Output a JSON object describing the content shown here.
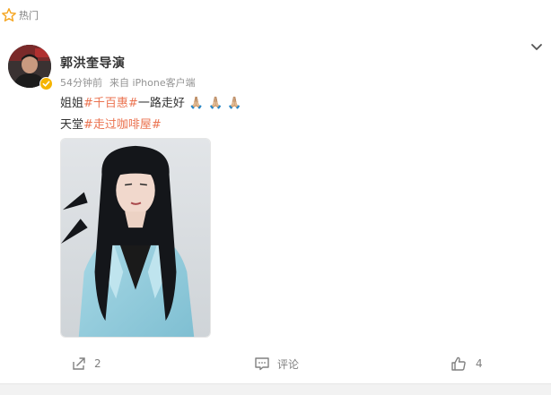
{
  "header": {
    "hot_label": "热门"
  },
  "post": {
    "author": "郭洪奎导演",
    "time": "54分钟前",
    "source": "来自 iPhone客户端",
    "line1": {
      "before": "姐姐",
      "topic": "#千百惠#",
      "after": "一路走好",
      "emoji": "🙏🏼"
    },
    "line2": {
      "before": "天堂",
      "topic": "#走过咖啡屋#"
    }
  },
  "actions": {
    "share_count": "2",
    "comment_label": "评论",
    "like_count": "4"
  },
  "icons": {
    "hot": "star-icon",
    "verify": "verified-badge-icon",
    "menu": "chevron-down-icon",
    "share": "share-icon",
    "comment": "comment-icon",
    "like": "thumbs-up-icon"
  },
  "colors": {
    "topic": "#eb7350",
    "badge": "#f5b400",
    "text": "#333333",
    "meta": "#939393"
  }
}
